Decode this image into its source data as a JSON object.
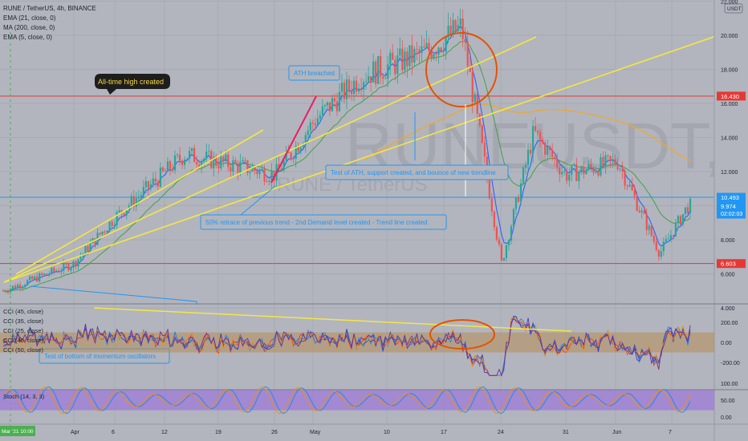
{
  "header": {
    "symbol_line": "RUNE / TetherUS, 4h, BINANCE",
    "indicators": [
      "EMA (21, close, 0)",
      "MA (200, close, 0)",
      "EMA (5, close, 0)"
    ],
    "currency": "USDT",
    "watermark": "RUNEUSDT, 4h",
    "watermark_sub": "RUNE / TetherUS"
  },
  "price_axis": {
    "ticks": [
      "22.000",
      "20.000",
      "18.000",
      "16.000",
      "14.000",
      "12.000",
      "10.000",
      "8.000",
      "6.000",
      "4.000"
    ],
    "tick_values": [
      22,
      20,
      18,
      16,
      14,
      12,
      10,
      8,
      6,
      4
    ]
  },
  "price_labels": {
    "resistance": {
      "text": "16.430",
      "value": 16.43,
      "color": "#e53935"
    },
    "mid": {
      "text": "10.493",
      "value": 10.493,
      "color": "#2196f3"
    },
    "current": {
      "text": "9.974",
      "value": 9.974,
      "color": "#2196f3"
    },
    "countdown": {
      "text": "02:02:03"
    },
    "support": {
      "text": "6.603",
      "value": 6.603,
      "color": "#e53935"
    }
  },
  "annotations": {
    "ath_created": "All-time high created",
    "ath_breached": "ATH breached",
    "test_ath": "Test of ATH, support created, and bounce of new trendline",
    "retrace": "50% retrace of previous trend - 2nd Demand level created - Trend line created",
    "momentum": "Test of bottom of momentum oscillators"
  },
  "cci_panel": {
    "legend": [
      "CCI (45, close)",
      "CCI (35, close)",
      "CCI (25, close)",
      "CCI (40, close)",
      "CCI (50, close)"
    ],
    "ticks": [
      "200.00",
      "0.00",
      "-200.00"
    ],
    "tick_values": [
      200,
      0,
      -200
    ],
    "band": [
      100,
      -100
    ]
  },
  "stoch_panel": {
    "legend": "Stoch (14, 3, 3)",
    "ticks": [
      "100.00",
      "50.00",
      "0.00"
    ],
    "tick_values": [
      100,
      50,
      0
    ],
    "band": [
      80,
      20
    ]
  },
  "time_axis": {
    "labels": [
      "Apr",
      "6",
      "12",
      "19",
      "26",
      "May",
      "10",
      "17",
      "24",
      "31",
      "Jun",
      "7",
      "14"
    ],
    "cursor_label": "Mar '21  10:00"
  },
  "colors": {
    "up": "#26a69a",
    "down": "#ef5350",
    "ema21": "#2962ff",
    "ma200": "#f5a623",
    "ema5": "#43a047",
    "trend": "#f5e642",
    "pink": "#e91e63",
    "orange_circle": "#e65100",
    "stoch_fill": "#9c7bd8"
  },
  "chart_data": {
    "type": "candlestick",
    "title": "RUNE / TetherUS, 4h, BINANCE",
    "ylabel": "USDT",
    "ylim": [
      2.8,
      23
    ],
    "x_dates": [
      "Mar '21",
      "Apr",
      "6",
      "12",
      "19",
      "26",
      "May",
      "10",
      "17",
      "24",
      "31",
      "Jun",
      "7",
      "14"
    ],
    "close_path": [
      [
        "Mar '21",
        5.0
      ],
      [
        "Apr",
        6.6
      ],
      [
        "6",
        9.3
      ],
      [
        "12",
        13.0
      ],
      [
        "19",
        12.3
      ],
      [
        "26",
        11.8
      ],
      [
        "May",
        15.0
      ],
      [
        "10",
        17.6
      ],
      [
        "17",
        19.0
      ],
      [
        "20",
        20.5
      ],
      [
        "24",
        6.6
      ],
      [
        "31",
        14.3
      ],
      [
        "Jun",
        11.8
      ],
      [
        "7",
        12.6
      ],
      [
        "14",
        7.2
      ],
      [
        "latest",
        9.974
      ]
    ],
    "levels": [
      16.43,
      10.493,
      6.603
    ],
    "current_price": 9.974
  }
}
